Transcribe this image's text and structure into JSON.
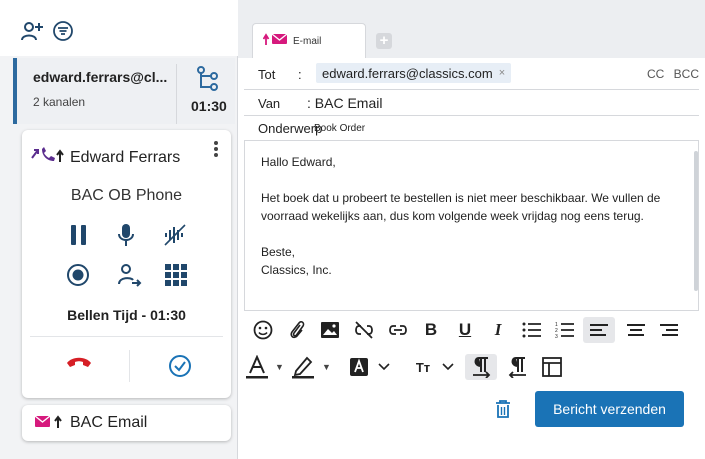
{
  "conversation": {
    "email": "edward.ferrars@cl...",
    "channels": "2 kanalen",
    "time": "01:30"
  },
  "call": {
    "contact_name": "Edward Ferrars",
    "channel_name": "BAC OB Phone",
    "timer": "Bellen Tijd - 01:30"
  },
  "email_item": {
    "label": "BAC Email"
  },
  "tab": {
    "label": "E-mail",
    "add": "+"
  },
  "form": {
    "to_label": "Tot",
    "to_colon": ":",
    "to_value": "edward.ferrars@classics.com",
    "remove_glyph": "×",
    "cc": "CC",
    "bcc": "BCC",
    "from_label": "Van",
    "from_value": ": BAC Email",
    "subject_label": "Onderwerp",
    "subject_value": "Book Order"
  },
  "body": {
    "greeting": "Hallo Edward,",
    "paragraph": "Het boek dat u probeert te bestellen is niet meer beschikbaar. We vullen de voorraad wekelijks aan, dus kom volgende week vrijdag nog eens terug.",
    "closing": "Beste,",
    "signature": "Classics, Inc."
  },
  "toolbar": {
    "row1": [
      "emoji-icon",
      "attachment-icon",
      "image-icon",
      "unlink-icon",
      "link-icon",
      "bold-icon",
      "underline-icon",
      "italic-icon",
      "bullet-list-icon",
      "numbered-list-icon",
      "align-left-icon",
      "align-center-icon",
      "align-right-icon"
    ],
    "row2": [
      "font-color-icon",
      "highlight-icon",
      "background-color-icon",
      "font-size-icon",
      "ltr-icon",
      "rtl-icon",
      "table-icon"
    ],
    "bold_glyph": "B",
    "underline_glyph": "U",
    "italic_glyph": "I",
    "fontsize_glyph": "Tт"
  },
  "actions": {
    "send_label": "Bericht verzenden"
  },
  "colors": {
    "accent": "#1a73b6",
    "brand_magenta": "#d6197d",
    "purple": "#5b2d8e",
    "hangup_red": "#d61f26",
    "dark_blue": "#20476b"
  }
}
